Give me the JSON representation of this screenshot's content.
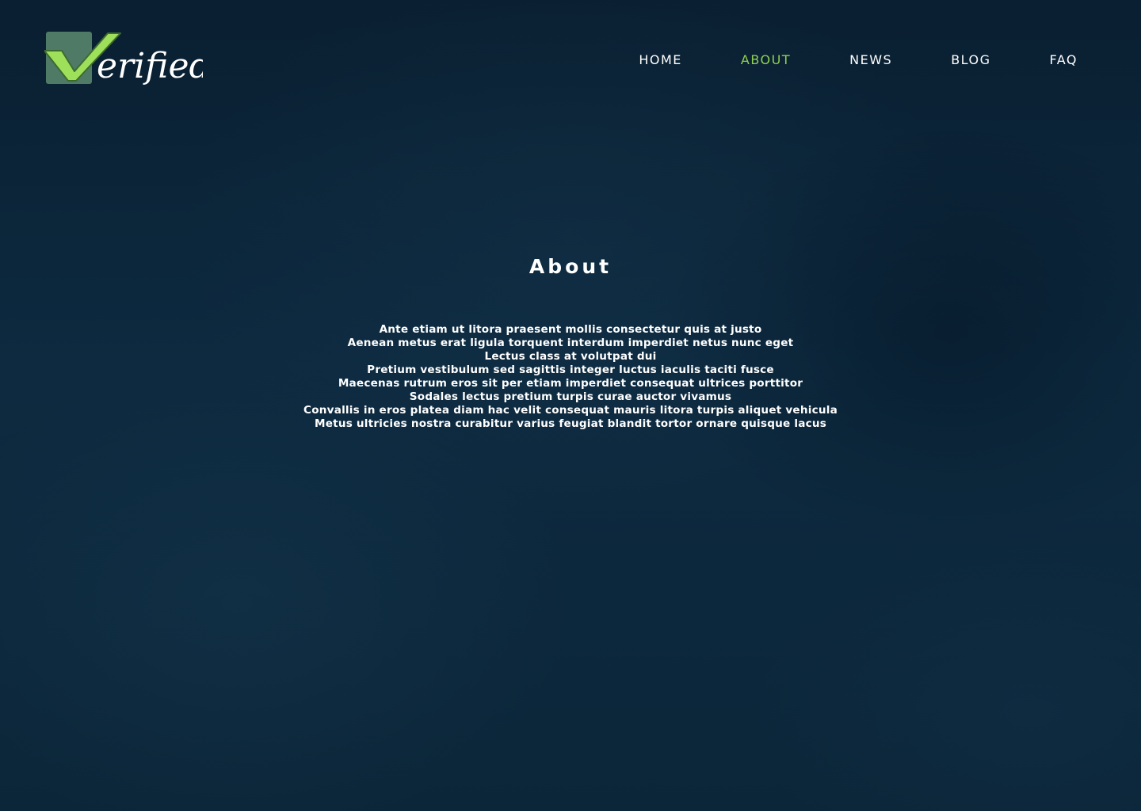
{
  "brand": {
    "logo_text": "Verified",
    "colors": {
      "check_fill": "#8fd14f",
      "check_box": "#4e7a66",
      "nav_active": "#8fd14f",
      "background": "#0b2234"
    }
  },
  "nav": {
    "items": [
      {
        "label": "HOME",
        "active": false
      },
      {
        "label": "ABOUT",
        "active": true
      },
      {
        "label": "NEWS",
        "active": false
      },
      {
        "label": "BLOG",
        "active": false
      },
      {
        "label": "FAQ",
        "active": false
      }
    ]
  },
  "main": {
    "title": "About",
    "lines": [
      "Ante etiam ut litora praesent mollis consectetur quis at justo",
      "Aenean metus erat ligula torquent interdum imperdiet netus nunc eget",
      "Lectus class at volutpat dui",
      "Pretium vestibulum sed sagittis integer luctus iaculis taciti fusce",
      "Maecenas rutrum eros sit per etiam imperdiet consequat ultrices porttitor",
      "Sodales lectus pretium turpis curae auctor vivamus",
      "Convallis in eros platea diam hac velit consequat mauris litora turpis aliquet vehicula",
      "Metus ultricies nostra curabitur varius feugiat blandit tortor ornare quisque lacus"
    ]
  }
}
